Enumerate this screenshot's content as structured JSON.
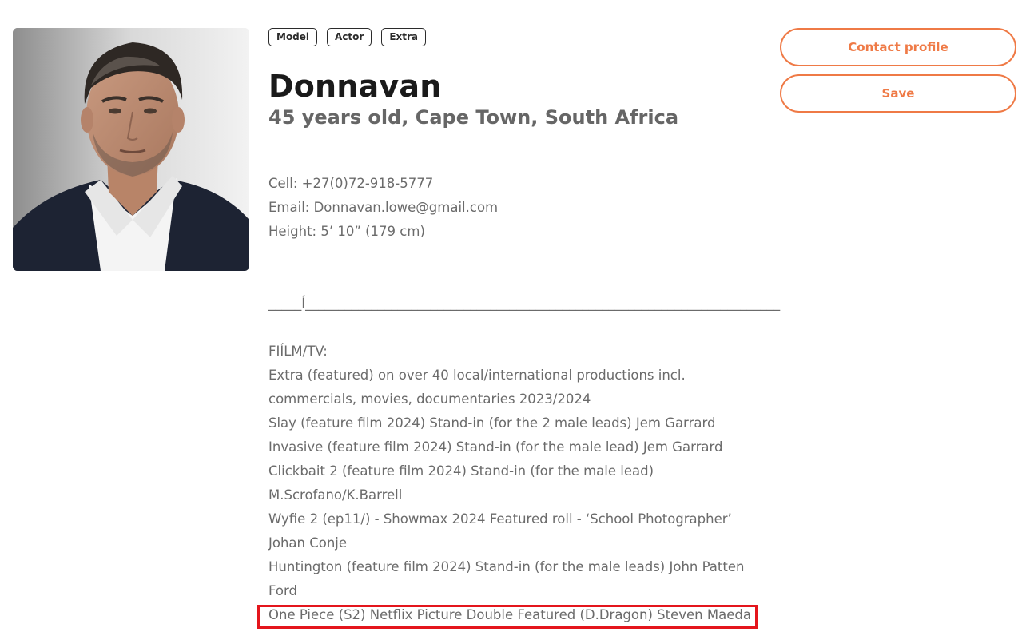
{
  "profile": {
    "tags": [
      "Model",
      "Actor",
      "Extra"
    ],
    "name": "Donnavan",
    "subtitle": "45 years old, Cape Town, South Africa",
    "photo_alt": "profile-photo"
  },
  "actions": {
    "contact_label": "Contact profile",
    "save_label": "Save"
  },
  "description": {
    "contact": [
      "Cell: +27(0)72-918-5777",
      "Email: Donnavan.lowe@gmail.com",
      "Height: 5’ 10” (179 cm)"
    ],
    "divider": "_____Í________________________________________________________________________",
    "section_heading": "FIÍLM/TV:",
    "credits": [
      "Extra (featured) on over 40 local/international productions incl.",
      "commercials, movies, documentaries 2023/2024",
      "Slay (feature film 2024) Stand-in (for the 2 male leads) Jem Garrard",
      "Invasive (feature film 2024) Stand-in (for the male lead) Jem Garrard",
      "Clickbait 2 (feature film 2024) Stand-in (for the male lead)",
      "M.Scrofano/K.Barrell",
      "Wyfie 2 (ep11/) - Showmax 2024 Featured roll - ‘School Photographer’",
      "Johan Conje",
      "Huntington (feature film 2024) Stand-in (for the male leads) John Patten",
      "Ford",
      "One Piece (S2) Netflix Picture Double Featured (D.Dragon) Steven Maeda"
    ]
  },
  "colors": {
    "accent": "#ef7a46",
    "highlight_border": "#e4151c",
    "name_text": "#1a1a1a",
    "body_text": "#6b6b6b"
  }
}
